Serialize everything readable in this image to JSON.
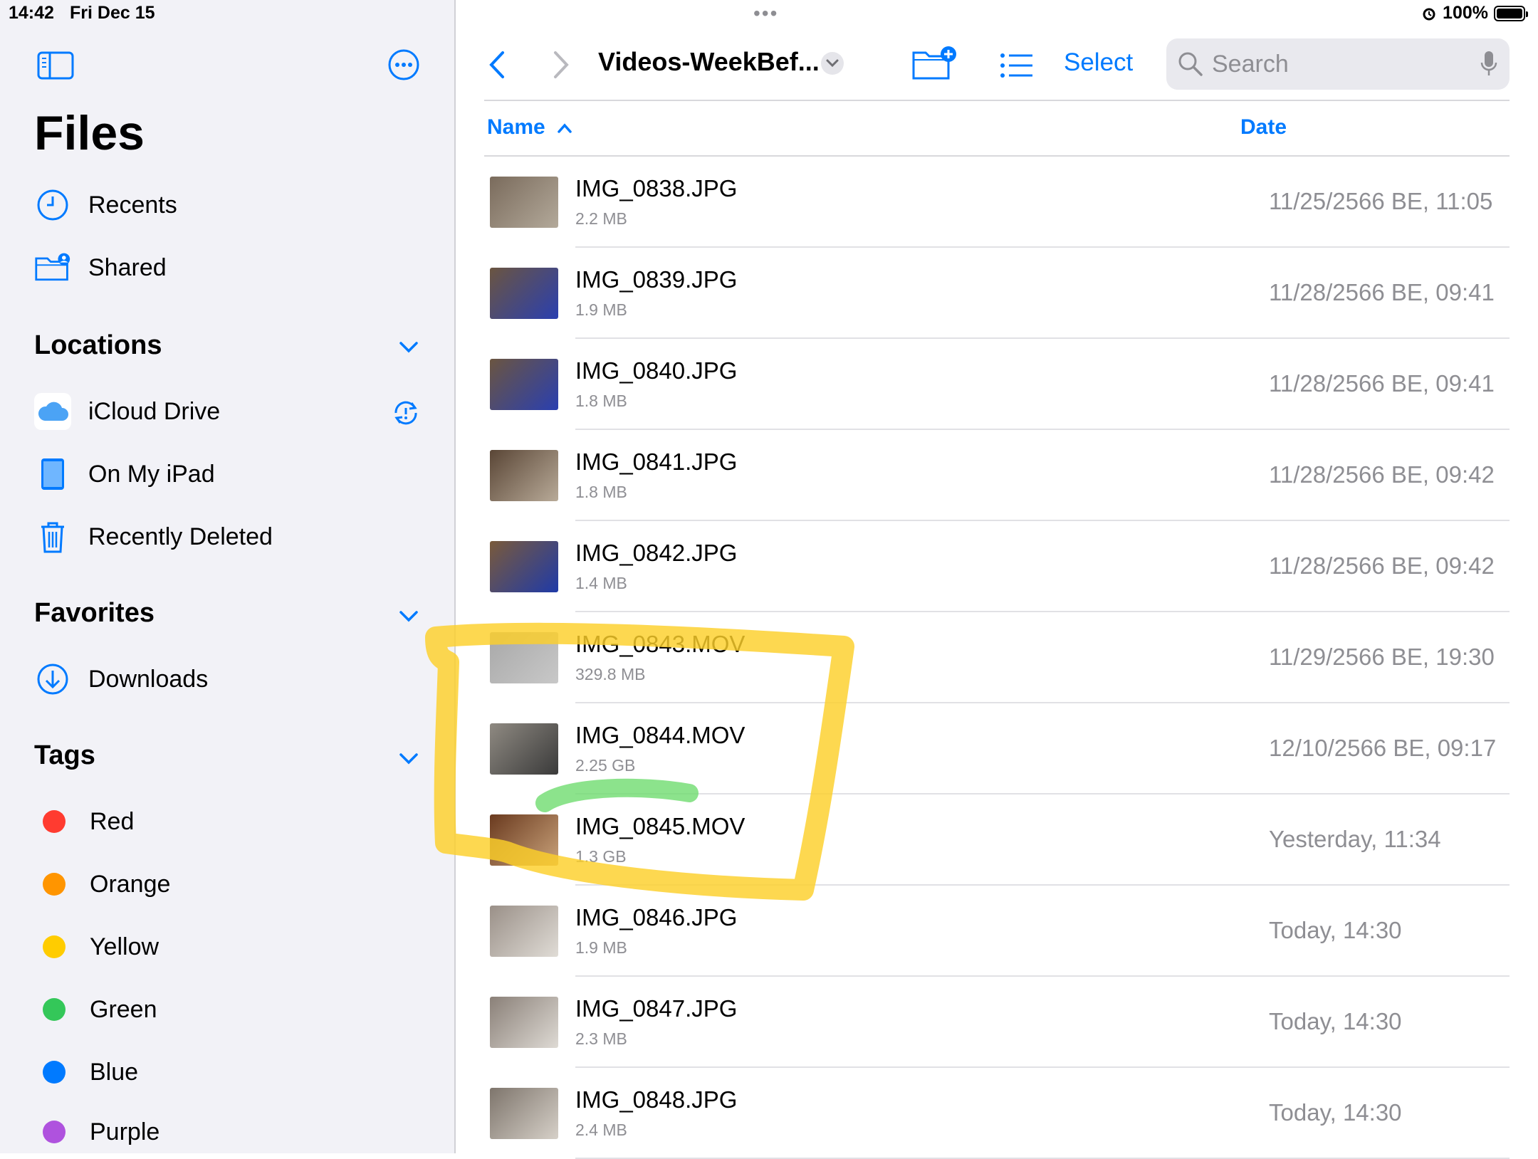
{
  "status": {
    "time": "14:42",
    "date": "Fri Dec 15",
    "battery": "100%"
  },
  "sidebar": {
    "title": "Files",
    "items": [
      {
        "label": "Recents",
        "icon": "clock-icon"
      },
      {
        "label": "Shared",
        "icon": "shared-folder-icon"
      }
    ],
    "locations": {
      "header": "Locations",
      "items": [
        {
          "label": "iCloud Drive",
          "icon": "icloud-icon"
        },
        {
          "label": "On My iPad",
          "icon": "ipad-icon"
        },
        {
          "label": "Recently Deleted",
          "icon": "trash-icon"
        }
      ]
    },
    "favorites": {
      "header": "Favorites",
      "items": [
        {
          "label": "Downloads",
          "icon": "download-icon"
        }
      ]
    },
    "tags": {
      "header": "Tags",
      "items": [
        {
          "label": "Red",
          "color": "#ff3b30"
        },
        {
          "label": "Orange",
          "color": "#ff9500"
        },
        {
          "label": "Yellow",
          "color": "#ffcc00"
        },
        {
          "label": "Green",
          "color": "#34c759"
        },
        {
          "label": "Blue",
          "color": "#007aff"
        },
        {
          "label": "Purple",
          "color": "#af52de"
        }
      ]
    }
  },
  "toolbar": {
    "folder_title": "Videos-WeekBef...",
    "select_label": "Select",
    "search_placeholder": "Search"
  },
  "columns": {
    "name": "Name",
    "date": "Date"
  },
  "files": [
    {
      "name": "IMG_0838.JPG",
      "size": "2.2 MB",
      "date": "11/25/2566 BE, 11:05",
      "thumb": [
        "#7a6b5c",
        "#b3a99a"
      ]
    },
    {
      "name": "IMG_0839.JPG",
      "size": "1.9 MB",
      "date": "11/28/2566 BE, 09:41",
      "thumb": [
        "#6b5540",
        "#2a3fb0"
      ]
    },
    {
      "name": "IMG_0840.JPG",
      "size": "1.8 MB",
      "date": "11/28/2566 BE, 09:41",
      "thumb": [
        "#6b5540",
        "#2a3fb0"
      ]
    },
    {
      "name": "IMG_0841.JPG",
      "size": "1.8 MB",
      "date": "11/28/2566 BE, 09:42",
      "thumb": [
        "#5a4636",
        "#b8aa98"
      ]
    },
    {
      "name": "IMG_0842.JPG",
      "size": "1.4 MB",
      "date": "11/28/2566 BE, 09:42",
      "thumb": [
        "#7a5a3a",
        "#1f3aa8"
      ]
    },
    {
      "name": "IMG_0843.MOV",
      "size": "329.8 MB",
      "date": "11/29/2566 BE, 19:30",
      "thumb": [
        "#a8a8a8",
        "#c8c8c8"
      ]
    },
    {
      "name": "IMG_0844.MOV",
      "size": "2.25 GB",
      "date": "12/10/2566 BE, 09:17",
      "thumb": [
        "#8f8a82",
        "#3a3a3a"
      ]
    },
    {
      "name": "IMG_0845.MOV",
      "size": "1.3 GB",
      "date": "Yesterday, 11:34",
      "thumb": [
        "#6a3a1f",
        "#c9a27a"
      ]
    },
    {
      "name": "IMG_0846.JPG",
      "size": "1.9 MB",
      "date": "Today, 14:30",
      "thumb": [
        "#9a9088",
        "#e0dcd6"
      ]
    },
    {
      "name": "IMG_0847.JPG",
      "size": "2.3 MB",
      "date": "Today, 14:30",
      "thumb": [
        "#8a8078",
        "#dedad4"
      ]
    },
    {
      "name": "IMG_0848.JPG",
      "size": "2.4 MB",
      "date": "Today, 14:30",
      "thumb": [
        "#7e756c",
        "#d6d0c8"
      ]
    }
  ]
}
